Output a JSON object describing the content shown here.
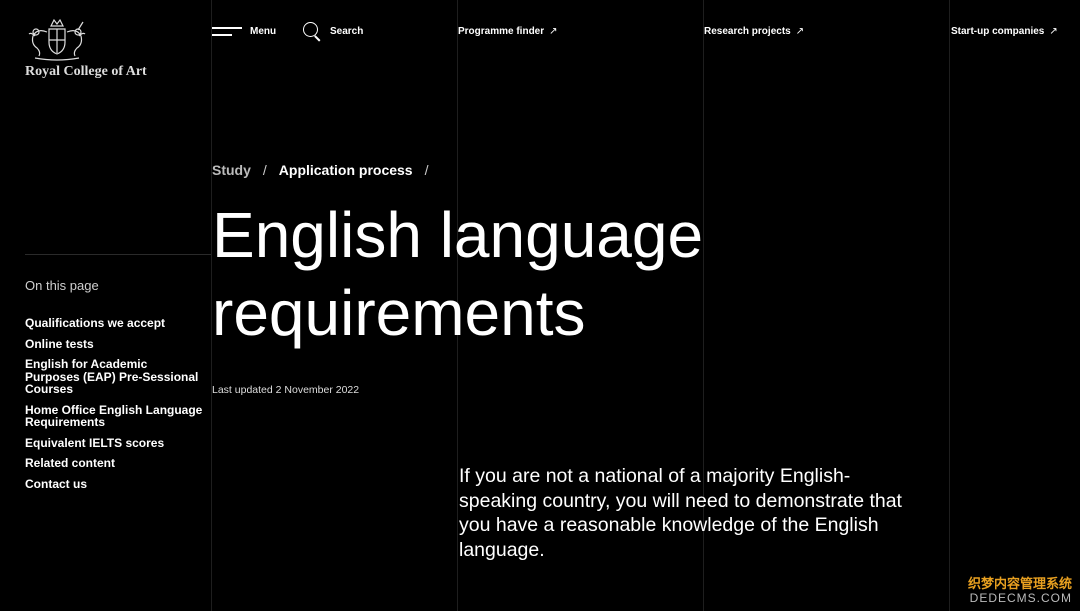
{
  "logo": {
    "text": "Royal College of Art"
  },
  "nav": {
    "menu": "Menu",
    "search": "Search",
    "programme_finder": "Programme finder",
    "research_projects": "Research projects",
    "startup_companies": "Start-up companies",
    "external_arrow": "↗"
  },
  "breadcrumb": {
    "items": [
      "Study",
      "Application process"
    ],
    "separator": "/"
  },
  "page": {
    "title": "English language requirements",
    "last_updated": "Last updated 2 November 2022",
    "intro": "If you are not a national of a majority English-speaking country, you will need to demonstrate that you have a reasonable knowledge of the English language."
  },
  "sidebar": {
    "heading": "On this page",
    "items": [
      {
        "label": "Qualifications we accept"
      },
      {
        "label": "Online tests"
      },
      {
        "label": "English for Academic Purposes (EAP) Pre-Sessional Courses"
      },
      {
        "label": "Home Office English Language Requirements"
      },
      {
        "label": "Equivalent IELTS scores"
      },
      {
        "label": "Related content"
      },
      {
        "label": "Contact us"
      }
    ]
  },
  "watermark": {
    "line1": "织梦内容管理系统",
    "line2": "DEDECMS.COM"
  },
  "colors": {
    "background": "#000000",
    "text": "#ffffff",
    "muted": "#bbbbbb",
    "grid_line": "#1e1e1e"
  }
}
